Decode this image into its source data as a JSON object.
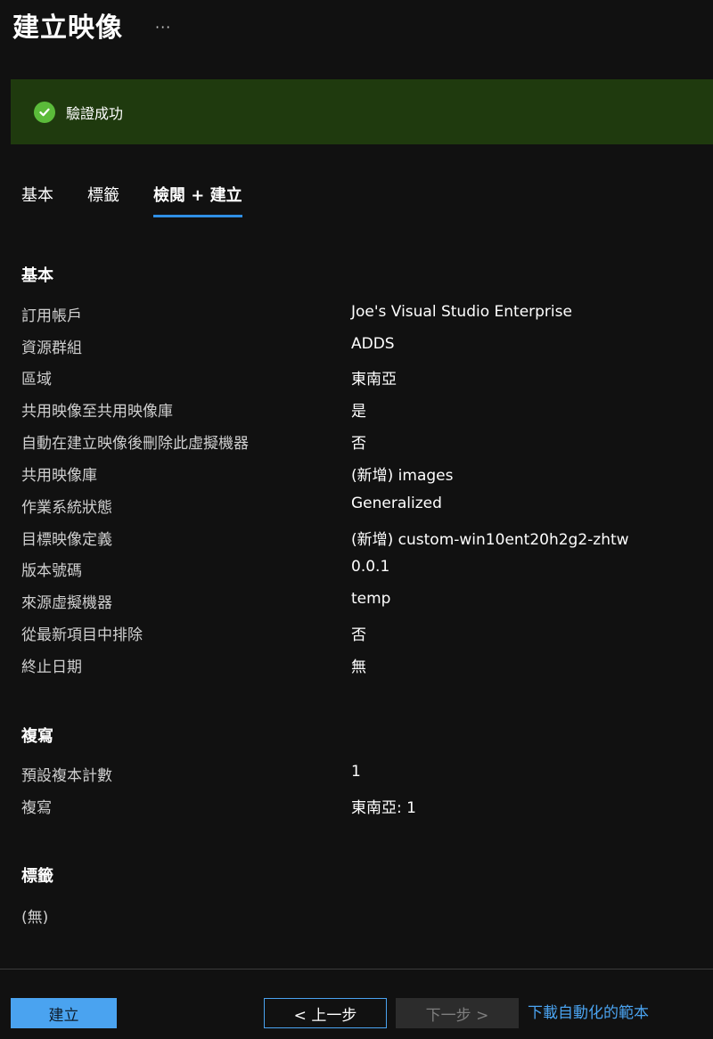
{
  "header": {
    "title": "建立映像",
    "more": "···"
  },
  "banner": {
    "message": "驗證成功",
    "color": "#1f3a0e",
    "icon": "check-circle-icon"
  },
  "tabs": [
    {
      "label": "基本"
    },
    {
      "label": "標籤"
    },
    {
      "label": "檢閱 + 建立",
      "active": true
    }
  ],
  "basics": {
    "title": "基本",
    "rows": [
      {
        "label": "訂用帳戶",
        "value": "Joe's Visual Studio Enterprise"
      },
      {
        "label": "資源群組",
        "value": "ADDS"
      },
      {
        "label": "區域",
        "value": "東南亞"
      },
      {
        "label": "共用映像至共用映像庫",
        "value": "是"
      },
      {
        "label": "自動在建立映像後刪除此虛擬機器",
        "value": "否"
      },
      {
        "label": "共用映像庫",
        "value": "(新增) images"
      },
      {
        "label": "作業系統狀態",
        "value": "Generalized"
      },
      {
        "label": "目標映像定義",
        "value": "(新增) custom-win10ent20h2g2-zhtw"
      },
      {
        "label": "版本號碼",
        "value": "0.0.1"
      },
      {
        "label": "來源虛擬機器",
        "value": "temp"
      },
      {
        "label": "從最新項目中排除",
        "value": "否"
      },
      {
        "label": "終止日期",
        "value": "無"
      }
    ]
  },
  "replication": {
    "title": "複寫",
    "rows": [
      {
        "label": "預設複本計數",
        "value": "1"
      },
      {
        "label": "複寫",
        "value": "東南亞: 1"
      }
    ]
  },
  "tags": {
    "title": "標籤",
    "empty": "(無)"
  },
  "footer": {
    "create": "建立",
    "previous": "< 上一步",
    "next": "下一步 >",
    "download_link": "下載自動化的範本",
    "accent": "#4aa3f0"
  }
}
